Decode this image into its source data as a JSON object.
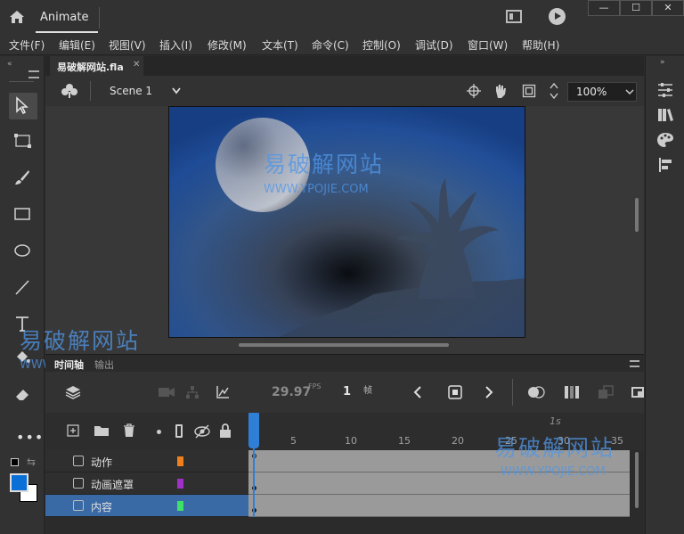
{
  "app": {
    "title": "Animate",
    "window_controls": {
      "minimize": "—",
      "maximize": "☐",
      "close": "✕"
    }
  },
  "menu": {
    "items": [
      "文件(F)",
      "编辑(E)",
      "视图(V)",
      "插入(I)",
      "修改(M)",
      "文本(T)",
      "命令(C)",
      "控制(O)",
      "调试(D)",
      "窗口(W)",
      "帮助(H)"
    ]
  },
  "document": {
    "tab_label": "易破解网站.fla",
    "close_glyph": "✕",
    "scene": "Scene 1",
    "zoom": "100%"
  },
  "watermark": {
    "cn": "易破解网站",
    "en": "WWW.YPOJIE.COM"
  },
  "timeline": {
    "tabs": [
      "时间轴",
      "输出"
    ],
    "fps_value": "29.97",
    "fps_unit": "FPS",
    "current_frame": "1",
    "frame_unit": "帧",
    "seconds_marker": "1s",
    "ruler_ticks": [
      "5",
      "10",
      "15",
      "20",
      "25",
      "30",
      "35"
    ],
    "layers": [
      {
        "name": "动作",
        "color": "#f07f1e",
        "selected": false
      },
      {
        "name": "动画遮罩",
        "color": "#a030c8",
        "selected": false
      },
      {
        "name": "内容",
        "color": "#3ee06a",
        "selected": true
      }
    ]
  },
  "colors": {
    "stroke": "#ffffff",
    "fill": "#0a6fd6",
    "accent_selection": "#3a6aa6",
    "playhead": "#2f7fd6"
  },
  "icons": {
    "toolbar": [
      "selection-tool-icon",
      "free-transform-icon",
      "brush-icon",
      "rectangle-icon",
      "oval-icon",
      "line-icon",
      "text-icon",
      "paint-bucket-icon",
      "eraser-icon",
      "more-tools-icon"
    ],
    "right_panel": [
      "properties-icon",
      "library-icon",
      "color-icon",
      "align-icon"
    ]
  }
}
